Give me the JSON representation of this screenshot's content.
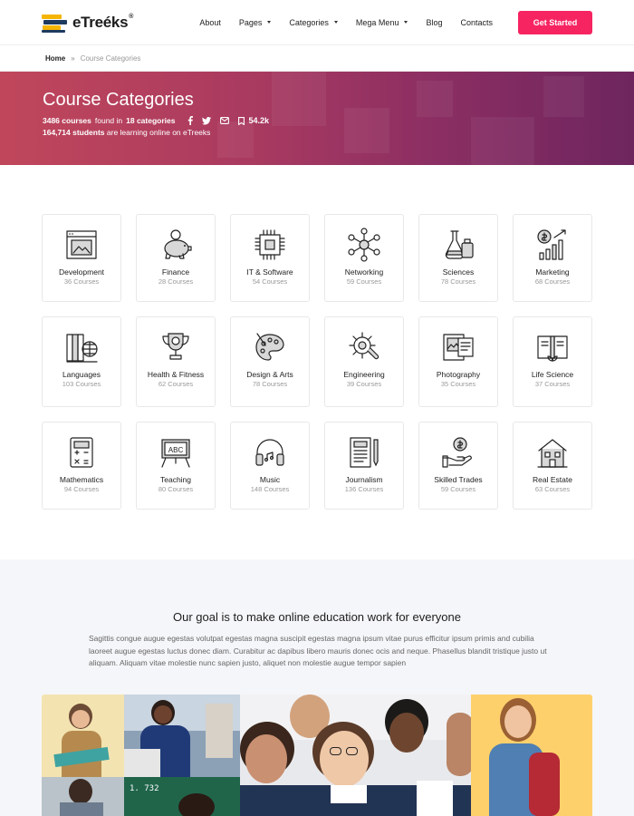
{
  "nav": {
    "brand": "eTreéks",
    "brand_mark": "®",
    "items": [
      {
        "label": "About",
        "dropdown": false
      },
      {
        "label": "Pages",
        "dropdown": true
      },
      {
        "label": "Categories",
        "dropdown": true
      },
      {
        "label": "Mega Menu",
        "dropdown": true
      },
      {
        "label": "Blog",
        "dropdown": false
      },
      {
        "label": "Contacts",
        "dropdown": false
      }
    ],
    "cta": "Get Started"
  },
  "breadcrumb": {
    "home": "Home",
    "separator": "»",
    "current": "Course Categories"
  },
  "hero": {
    "title": "Course Categories",
    "courses_count": "3486 courses",
    "found_in": "found in",
    "categories_count": "18 categories",
    "bookmarks": "54.2k",
    "students_count": "164,714 students",
    "students_text": "are learning online on eTreeks"
  },
  "categories": [
    {
      "name": "Development",
      "count": "36 Courses",
      "icon": "browser-icon"
    },
    {
      "name": "Finance",
      "count": "28 Courses",
      "icon": "piggy-bank-icon"
    },
    {
      "name": "IT & Software",
      "count": "54 Courses",
      "icon": "chip-icon"
    },
    {
      "name": "Networking",
      "count": "59 Courses",
      "icon": "network-icon"
    },
    {
      "name": "Sciences",
      "count": "78 Courses",
      "icon": "flask-icon"
    },
    {
      "name": "Marketing",
      "count": "68 Courses",
      "icon": "growth-chart-icon"
    },
    {
      "name": "Languages",
      "count": "103 Courses",
      "icon": "books-globe-icon"
    },
    {
      "name": "Health & Fitness",
      "count": "62 Courses",
      "icon": "trophy-icon"
    },
    {
      "name": "Design & Arts",
      "count": "78 Courses",
      "icon": "palette-icon"
    },
    {
      "name": "Engineering",
      "count": "39 Courses",
      "icon": "gear-wrench-icon"
    },
    {
      "name": "Photography",
      "count": "35 Courses",
      "icon": "photo-icon"
    },
    {
      "name": "Life Science",
      "count": "37 Courses",
      "icon": "open-book-leaf-icon"
    },
    {
      "name": "Mathematics",
      "count": "94 Courses",
      "icon": "calculator-icon"
    },
    {
      "name": "Teaching",
      "count": "80 Courses",
      "icon": "blackboard-icon"
    },
    {
      "name": "Music",
      "count": "148 Courses",
      "icon": "headphones-icon"
    },
    {
      "name": "Journalism",
      "count": "136 Courses",
      "icon": "document-pen-icon"
    },
    {
      "name": "Skilled Trades",
      "count": "59 Courses",
      "icon": "hand-coin-icon"
    },
    {
      "name": "Real Estate",
      "count": "63 Courses",
      "icon": "house-icon"
    }
  ],
  "goal": {
    "title": "Our goal is to make online education work for everyone",
    "text": "Sagittis congue augue egestas volutpat egestas magna suscipit egestas magna ipsum vitae purus efficitur ipsum primis and cubilia laoreet augue egestas luctus donec diam. Curabitur ac dapibus libero mauris donec ocis and neque. Phasellus blandit tristique justo ut aliquam. Aliquam vitae molestie nunc sapien justo, aliquet non molestie augue tempor sapien"
  },
  "colors": {
    "accent": "#f72462",
    "hero_start": "#c0475b",
    "hero_end": "#6e255e",
    "logo_yellow": "#f5b400",
    "logo_blue": "#1e3a5f"
  },
  "photos": {
    "icon": "students-photo-collage",
    "board_text": "1. 732"
  }
}
